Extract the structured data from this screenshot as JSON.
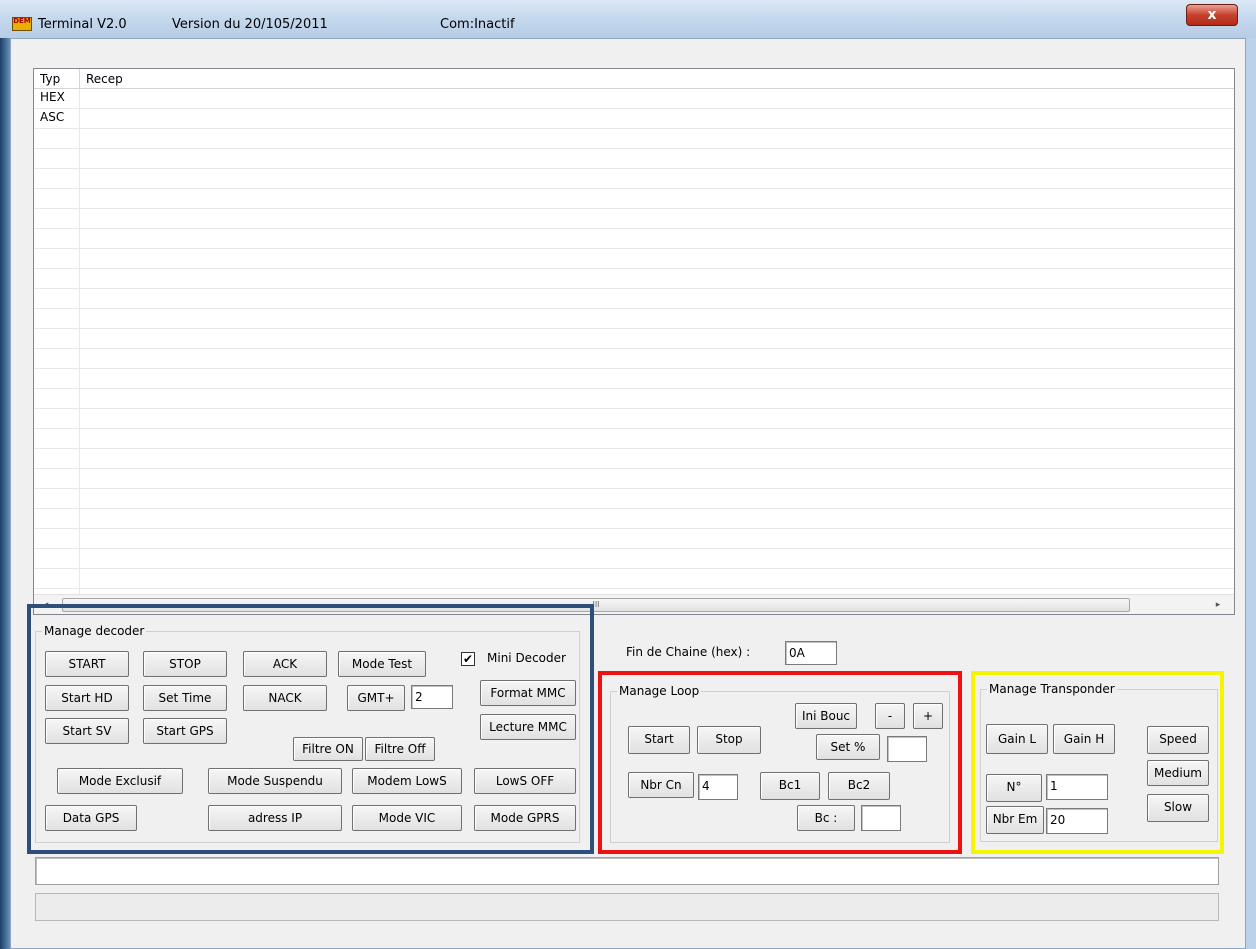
{
  "window": {
    "app_name": "Terminal V2.0",
    "version": "Version du 20/105/2011",
    "com_status": "Com:Inactif",
    "close_glyph": "x",
    "icon_text": "DEM"
  },
  "listview": {
    "columns": [
      "Typ",
      "Recep"
    ],
    "rows": [
      "HEX",
      "ASC"
    ],
    "scroll_left": "◂",
    "scroll_right": "▸",
    "thumb_grip": "III"
  },
  "decoder": {
    "title": "Manage decoder",
    "start": "START",
    "stop": "STOP",
    "ack": "ACK",
    "mode_test": "Mode Test",
    "mini_decoder_label": "Mini Decoder",
    "mini_decoder_checked": true,
    "start_hd": "Start HD",
    "set_time": "Set Time",
    "nack": "NACK",
    "gmt_plus": "GMT+",
    "gmt_value": "2",
    "format_mmc": "Format MMC",
    "start_sv": "Start SV",
    "start_gps": "Start GPS",
    "lecture_mmc": "Lecture MMC",
    "filtre_on": "Filtre ON",
    "filtre_off": "Filtre Off",
    "mode_exclusif": "Mode Exclusif",
    "mode_suspendu": "Mode Suspendu",
    "modem_lows": "Modem LowS",
    "lows_off": "LowS OFF",
    "data_gps": "Data GPS",
    "adress_ip": "adress IP",
    "mode_vic": "Mode VIC",
    "mode_gprs": "Mode GPRS",
    "highlight_color": "#2e4e7e"
  },
  "fin_chaine": {
    "label": "Fin de Chaine (hex) :",
    "value": "0A"
  },
  "loop": {
    "title": "Manage Loop",
    "ini_bouc": "Ini Bouc",
    "minus": "-",
    "plus": "+",
    "start": "Start",
    "stop": "Stop",
    "set_pct": "Set %",
    "set_pct_value": "",
    "nbr_cn": "Nbr Cn",
    "nbr_cn_value": "4",
    "bc1": "Bc1",
    "bc2": "Bc2",
    "bc": "Bc :",
    "bc_value": "",
    "highlight_color": "#ee1111"
  },
  "transponder": {
    "title": "Manage Transponder",
    "gain_l": "Gain L",
    "gain_h": "Gain H",
    "speed": "Speed",
    "medium": "Medium",
    "slow": "Slow",
    "n_deg": "N°",
    "n_value": "1",
    "nbr_em": "Nbr Em",
    "nbr_em_value": "20",
    "highlight_color": "#f5f500"
  },
  "status": {
    "input_value": "",
    "bar_text": ""
  }
}
